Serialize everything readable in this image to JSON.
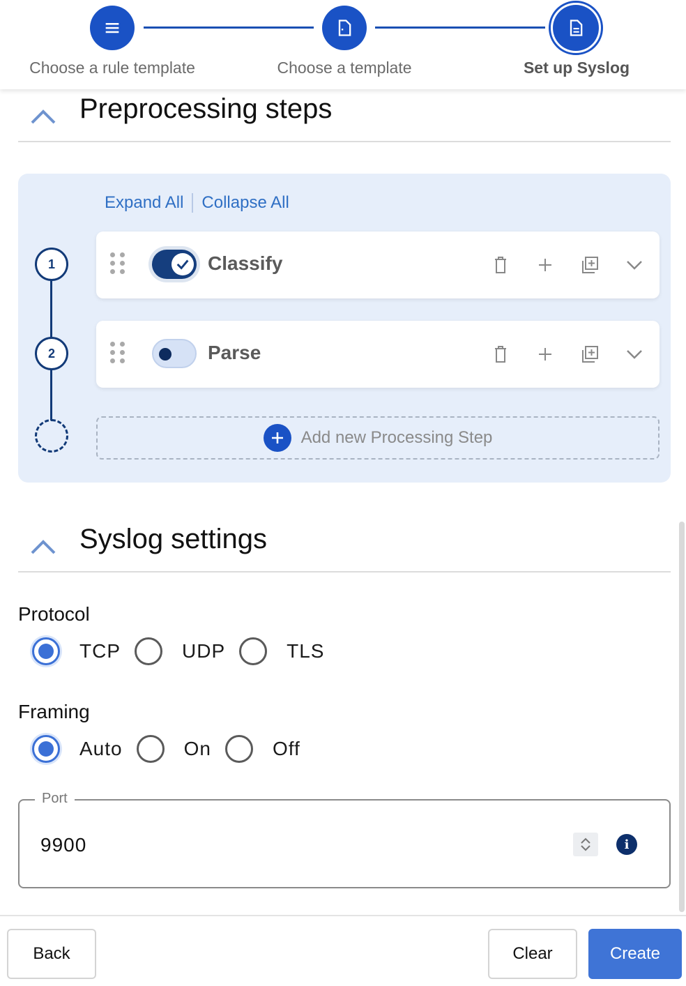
{
  "stepper": {
    "steps": [
      {
        "label": "Choose a rule template",
        "icon": "menu-icon",
        "state": "complete"
      },
      {
        "label": "Choose a template",
        "icon": "document-icon",
        "state": "complete"
      },
      {
        "label": "Set up Syslog",
        "icon": "document-lines-icon",
        "state": "active"
      }
    ]
  },
  "preprocessing": {
    "title": "Preprocessing steps",
    "expand_all": "Expand All",
    "collapse_all": "Collapse All",
    "steps": [
      {
        "number": "1",
        "label": "Classify",
        "enabled": true
      },
      {
        "number": "2",
        "label": "Parse",
        "enabled": false
      }
    ],
    "add_step_label": "Add new Processing Step"
  },
  "syslog": {
    "title": "Syslog settings",
    "protocol": {
      "label": "Protocol",
      "options": [
        "TCP",
        "UDP",
        "TLS"
      ],
      "selected": "TCP"
    },
    "framing": {
      "label": "Framing",
      "options": [
        "Auto",
        "On",
        "Off"
      ],
      "selected": "Auto"
    },
    "port": {
      "label": "Port",
      "value": "9900"
    }
  },
  "footer": {
    "back_label": "Back",
    "clear_label": "Clear",
    "create_label": "Create"
  },
  "colors": {
    "primary": "#1a52c5",
    "accent_button": "#3f74d6",
    "panel_bg": "#e6eefa"
  }
}
